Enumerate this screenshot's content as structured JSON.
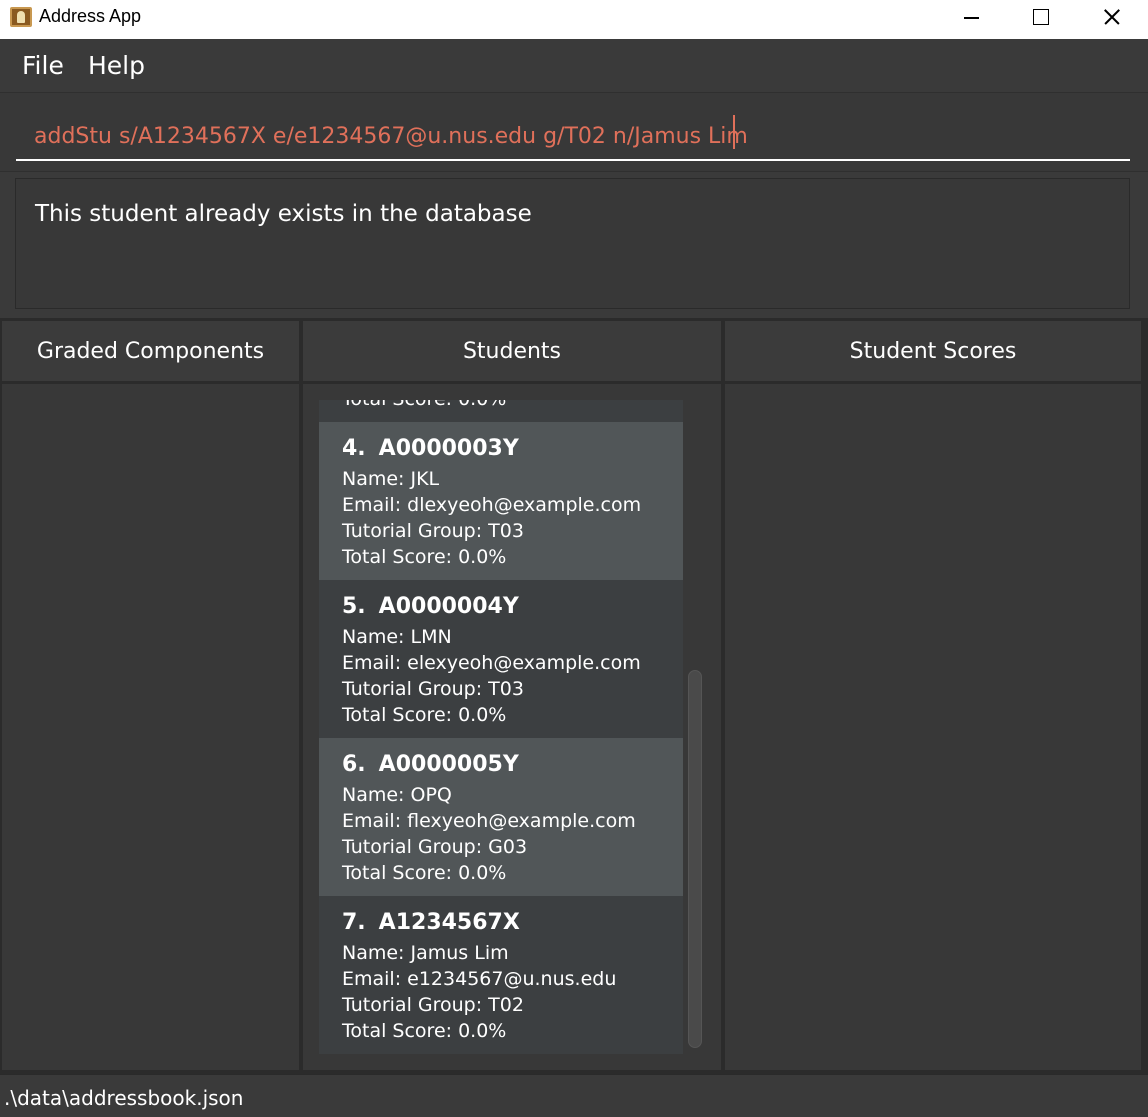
{
  "window": {
    "title": "Address App"
  },
  "menu": {
    "file": "File",
    "help": "Help"
  },
  "command": {
    "value": "addStu s/A1234567X e/e1234567@u.nus.edu g/T02 n/Jamus Lim"
  },
  "result": {
    "message": "This student already exists in the database"
  },
  "panels": {
    "graded_components": "Graded Components",
    "students": "Students",
    "student_scores": "Student Scores"
  },
  "students": {
    "partial_top": "Total Score: 0.0%",
    "items": [
      {
        "index": "4.",
        "id": "A0000003Y",
        "name": "Name: JKL",
        "email": "Email: dlexyeoh@example.com",
        "group": "Tutorial Group: T03",
        "score": "Total Score: 0.0%"
      },
      {
        "index": "5.",
        "id": "A0000004Y",
        "name": "Name: LMN",
        "email": "Email: elexyeoh@example.com",
        "group": "Tutorial Group: T03",
        "score": "Total Score: 0.0%"
      },
      {
        "index": "6.",
        "id": "A0000005Y",
        "name": "Name: OPQ",
        "email": "Email: flexyeoh@example.com",
        "group": "Tutorial Group: G03",
        "score": "Total Score: 0.0%"
      },
      {
        "index": "7.",
        "id": "A1234567X",
        "name": "Name: Jamus Lim",
        "email": "Email: e1234567@u.nus.edu",
        "group": "Tutorial Group: T02",
        "score": "Total Score: 0.0%"
      }
    ]
  },
  "status": {
    "path": ".\\data\\addressbook.json"
  },
  "colors": {
    "command_text": "#e0705a",
    "background": "#3a3a3a",
    "card_highlight": "#515658"
  }
}
